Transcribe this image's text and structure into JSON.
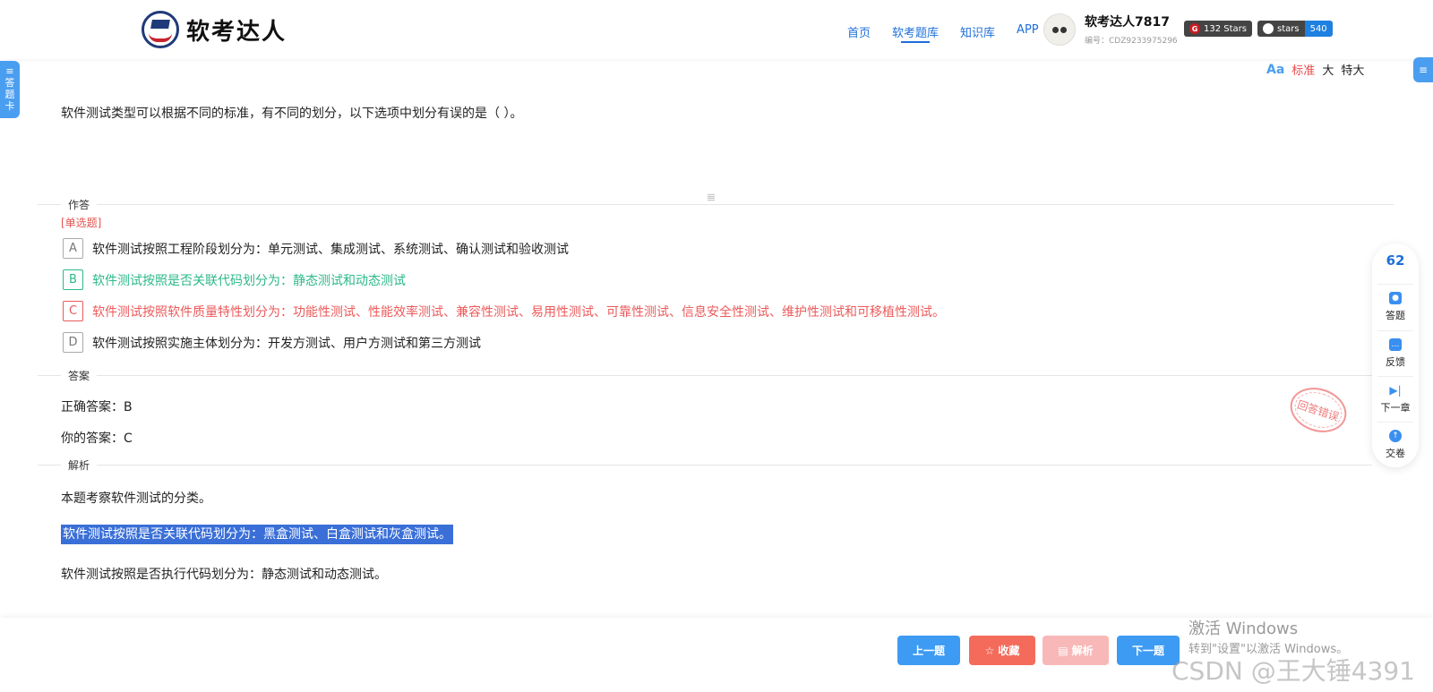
{
  "brand": {
    "name": "软考达人"
  },
  "nav": {
    "home": "首页",
    "questions": "软考题库",
    "knowledge": "知识库",
    "app": "APP"
  },
  "user": {
    "name": "软考达人7817",
    "id": "编号：CDZ9233975296"
  },
  "badges": {
    "gitee_icon": "G",
    "gitee_text": "132 Stars",
    "github_label": "stars",
    "github_count": "540"
  },
  "side_left": {
    "icon": "≡",
    "line1": "答",
    "line2": "题",
    "line3": "卡"
  },
  "side_right": {
    "icon": "≡"
  },
  "font_size": {
    "icon": "Aa",
    "standard": "标准",
    "large": "大",
    "xlarge": "特大"
  },
  "question": {
    "text": "软件测试类型可以根据不同的标准，有不同的划分，以下选项中划分有误的是（ ）。"
  },
  "sections": {
    "answer_area": "作答",
    "answer": "答案",
    "analysis": "解析"
  },
  "question_type": "[单选题]",
  "options": [
    {
      "letter": "A",
      "text": "软件测试按照工程阶段划分为：单元测试、集成测试、系统测试、确认测试和验收测试"
    },
    {
      "letter": "B",
      "text": "软件测试按照是否关联代码划分为：静态测试和动态测试"
    },
    {
      "letter": "C",
      "text": "软件测试按照软件质量特性划分为：功能性测试、性能效率测试、兼容性测试、易用性测试、可靠性测试、信息安全性测试、维护性测试和可移植性测试。"
    },
    {
      "letter": "D",
      "text": "软件测试按照实施主体划分为：开发方测试、用户方测试和第三方测试"
    }
  ],
  "answer": {
    "correct": "正确答案：B",
    "yours": "你的答案：C",
    "stamp": "回答错误"
  },
  "analysis": {
    "line1": "本题考察软件测试的分类。",
    "line2": "软件测试按照是否关联代码划分为：黑盒测试、白盒测试和灰盒测试。",
    "line3": "软件测试按照是否执行代码划分为：静态测试和动态测试。"
  },
  "float_panel": {
    "count": "62",
    "answer": "答题",
    "feedback": "反馈",
    "next_chapter": "下一章",
    "submit": "交卷"
  },
  "buttons": {
    "prev": "上一题",
    "favorite": "收藏",
    "analysis": "解析",
    "next": "下一题",
    "favorite_icon": "☆",
    "analysis_icon": "▤"
  },
  "watermark": {
    "line1": "激活 Windows",
    "line2": "转到\"设置\"以激活 Windows。",
    "line3": "CSDN @王大锤4391"
  },
  "colors": {
    "primary": "#3d9bf3",
    "correct": "#2bb98a",
    "wrong": "#ec5a5a",
    "highlight": "#3a6fd8"
  }
}
